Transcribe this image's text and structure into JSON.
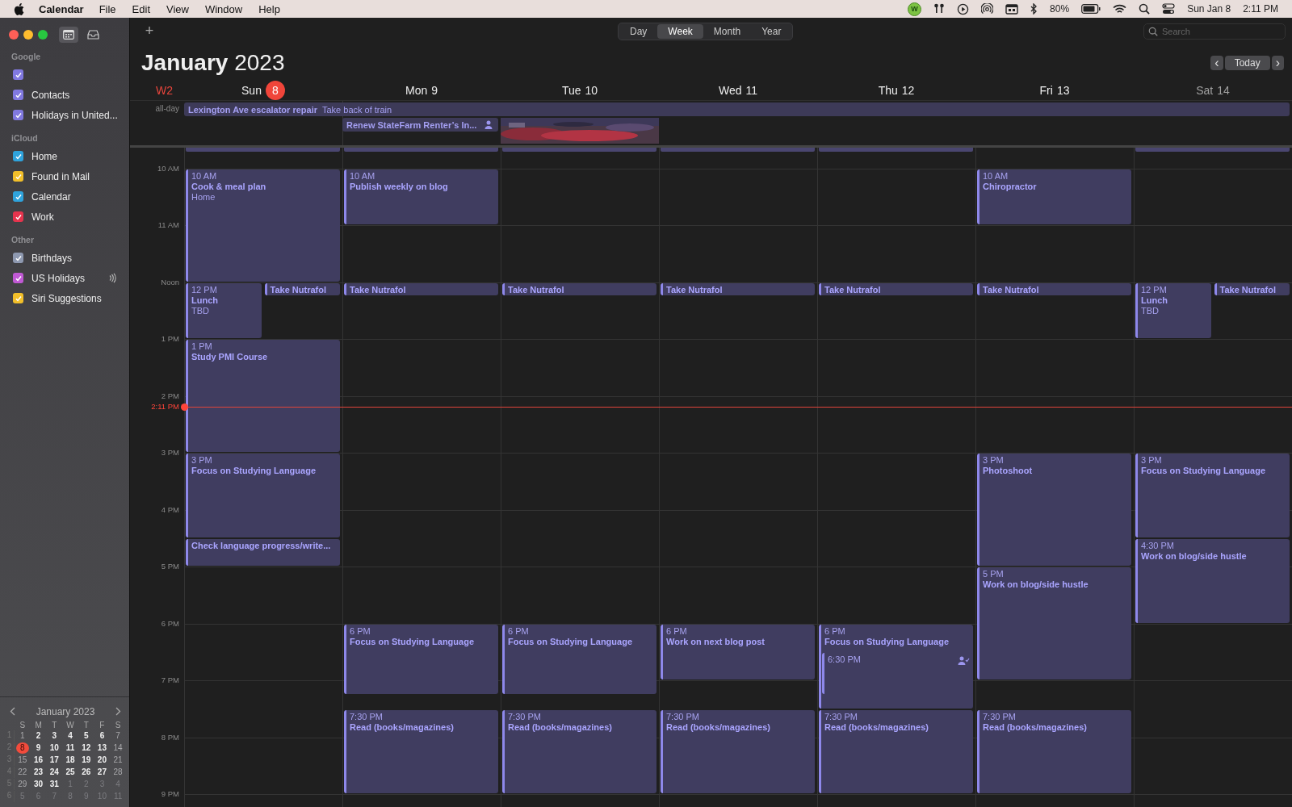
{
  "menu_bar": {
    "app": "Calendar",
    "menus": [
      "File",
      "Edit",
      "View",
      "Window",
      "Help"
    ],
    "status_badge": "W",
    "battery": "80%",
    "date": "Sun Jan 8",
    "time": "2:11 PM"
  },
  "sidebar": {
    "sections": [
      {
        "title": "Google",
        "items": [
          {
            "checked": true,
            "color": "#8179e0"
          },
          {
            "label": "Contacts",
            "checked": true,
            "color": "#8179e0"
          },
          {
            "label": "Holidays in United...",
            "checked": true,
            "color": "#8179e0"
          }
        ]
      },
      {
        "title": "iCloud",
        "items": [
          {
            "label": "Home",
            "checked": true,
            "color": "#2fa3dc"
          },
          {
            "label": "Found in Mail",
            "checked": true,
            "color": "#f2bf2a"
          },
          {
            "label": "Calendar",
            "checked": true,
            "color": "#2fa3dc"
          },
          {
            "label": "Work",
            "checked": true,
            "color": "#e5344d"
          }
        ]
      },
      {
        "title": "Other",
        "items": [
          {
            "label": "Birthdays",
            "checked": true,
            "color": "#8e99b0"
          },
          {
            "label": "US Holidays",
            "checked": true,
            "color": "#c059d4",
            "subscribed": true
          },
          {
            "label": "Siri Suggestions",
            "checked": true,
            "color": "#f2bf2a"
          }
        ]
      }
    ]
  },
  "mini_calendar": {
    "title": "January 2023",
    "weekdays": [
      "S",
      "M",
      "T",
      "W",
      "T",
      "F",
      "S"
    ],
    "weeks": [
      {
        "number": "1",
        "days": [
          {
            "label": "1",
            "muted": false,
            "selected": false
          },
          {
            "label": "2",
            "muted": false,
            "selected": false
          },
          {
            "label": "3",
            "muted": false,
            "selected": false
          },
          {
            "label": "4",
            "muted": false,
            "selected": false
          },
          {
            "label": "5",
            "muted": false,
            "selected": false
          },
          {
            "label": "6",
            "muted": false,
            "selected": false
          },
          {
            "label": "7",
            "muted": false,
            "selected": false
          }
        ]
      },
      {
        "number": "2",
        "days": [
          {
            "label": "8",
            "muted": false,
            "selected": true
          },
          {
            "label": "9",
            "muted": false,
            "selected": false
          },
          {
            "label": "10",
            "muted": false,
            "selected": false
          },
          {
            "label": "11",
            "muted": false,
            "selected": false
          },
          {
            "label": "12",
            "muted": false,
            "selected": false
          },
          {
            "label": "13",
            "muted": false,
            "selected": false
          },
          {
            "label": "14",
            "muted": false,
            "selected": false
          }
        ]
      },
      {
        "number": "3",
        "days": [
          {
            "label": "15",
            "muted": false,
            "selected": false
          },
          {
            "label": "16",
            "muted": false,
            "selected": false
          },
          {
            "label": "17",
            "muted": false,
            "selected": false
          },
          {
            "label": "18",
            "muted": false,
            "selected": false
          },
          {
            "label": "19",
            "muted": false,
            "selected": false
          },
          {
            "label": "20",
            "muted": false,
            "selected": false
          },
          {
            "label": "21",
            "muted": false,
            "selected": false
          }
        ]
      },
      {
        "number": "4",
        "days": [
          {
            "label": "22",
            "muted": false,
            "selected": false
          },
          {
            "label": "23",
            "muted": false,
            "selected": false
          },
          {
            "label": "24",
            "muted": false,
            "selected": false
          },
          {
            "label": "25",
            "muted": false,
            "selected": false
          },
          {
            "label": "26",
            "muted": false,
            "selected": false
          },
          {
            "label": "27",
            "muted": false,
            "selected": false
          },
          {
            "label": "28",
            "muted": false,
            "selected": false
          }
        ]
      },
      {
        "number": "5",
        "days": [
          {
            "label": "29",
            "muted": false,
            "selected": false
          },
          {
            "label": "30",
            "muted": false,
            "selected": false
          },
          {
            "label": "31",
            "muted": false,
            "selected": false
          },
          {
            "label": "1",
            "muted": true,
            "selected": false
          },
          {
            "label": "2",
            "muted": true,
            "selected": false
          },
          {
            "label": "3",
            "muted": true,
            "selected": false
          },
          {
            "label": "4",
            "muted": true,
            "selected": false
          }
        ]
      },
      {
        "number": "6",
        "days": [
          {
            "label": "5",
            "muted": true,
            "selected": false
          },
          {
            "label": "6",
            "muted": true,
            "selected": false
          },
          {
            "label": "7",
            "muted": true,
            "selected": false
          },
          {
            "label": "8",
            "muted": true,
            "selected": false
          },
          {
            "label": "9",
            "muted": true,
            "selected": false
          },
          {
            "label": "10",
            "muted": true,
            "selected": false
          },
          {
            "label": "11",
            "muted": true,
            "selected": false
          }
        ]
      }
    ]
  },
  "toolbar": {
    "add": "+",
    "views": [
      {
        "label": "Day",
        "selected": false
      },
      {
        "label": "Week",
        "selected": true
      },
      {
        "label": "Month",
        "selected": false
      },
      {
        "label": "Year",
        "selected": false
      }
    ],
    "search": {
      "placeholder": "Search"
    },
    "prev": "‹",
    "today": "Today",
    "next": "›"
  },
  "title": {
    "month": "January",
    "year": "2023"
  },
  "week_number": "W2",
  "all_day": {
    "label": "all-day",
    "rows": [
      [
        {
          "kind": "event",
          "wide": true,
          "title": "Lexington Ave escalator repair",
          "note": "Take back of train"
        }
      ],
      [
        {
          "kind": "empty"
        },
        {
          "kind": "event",
          "wide": false,
          "title": "Renew StateFarm Renter’s In...",
          "invitee": true
        },
        {
          "kind": "picture"
        }
      ]
    ]
  },
  "hours": [
    "10 AM",
    "11 AM",
    "Noon",
    "1 PM",
    "2 PM",
    "3 PM",
    "4 PM",
    "5 PM",
    "6 PM",
    "7 PM",
    "8 PM",
    "9 PM"
  ],
  "now": {
    "label": "2:11 PM"
  },
  "days": [
    {
      "name": "Sun",
      "number": "8",
      "today": true,
      "dimmed": false,
      "earlier_event": true,
      "events": [
        {
          "time": "10 AM",
          "title": "Cook & meal plan",
          "location": "Home"
        },
        {
          "time": "12 PM",
          "title": "Lunch",
          "location": "TBD"
        },
        {
          "title": "Take Nutrafol"
        },
        {
          "time": "1 PM",
          "title": "Study PMI Course"
        },
        {
          "time": "3 PM",
          "title": "Focus on Studying Language"
        },
        {
          "title": "Check language progress/write..."
        }
      ]
    },
    {
      "name": "Mon",
      "number": "9",
      "today": false,
      "dimmed": false,
      "earlier_event": true,
      "events": [
        {
          "time": "10 AM",
          "title": "Publish weekly on blog"
        },
        {
          "title": "Take Nutrafol"
        },
        {
          "time": "6 PM",
          "title": "Focus on Studying Language"
        },
        {
          "time": "7:30 PM",
          "title": "Read (books/magazines)"
        }
      ]
    },
    {
      "name": "Tue",
      "number": "10",
      "today": false,
      "dimmed": false,
      "earlier_event": true,
      "events": [
        {
          "title": "Take Nutrafol"
        },
        {
          "time": "6 PM",
          "title": "Focus on Studying Language"
        },
        {
          "time": "7:30 PM",
          "title": "Read (books/magazines)"
        }
      ]
    },
    {
      "name": "Wed",
      "number": "11",
      "today": false,
      "dimmed": false,
      "earlier_event": true,
      "events": [
        {
          "title": "Take Nutrafol"
        },
        {
          "time": "6 PM",
          "title": "Work on next blog post"
        },
        {
          "time": "7:30 PM",
          "title": "Read (books/magazines)"
        }
      ]
    },
    {
      "name": "Thu",
      "number": "12",
      "today": false,
      "dimmed": false,
      "earlier_event": true,
      "events": [
        {
          "title": "Take Nutrafol"
        },
        {
          "time": "6 PM",
          "title": "Focus on Studying Language"
        },
        {
          "time": "6:30 PM",
          "invitee": true
        },
        {
          "time": "7:30 PM",
          "title": "Read (books/magazines)"
        }
      ]
    },
    {
      "name": "Fri",
      "number": "13",
      "today": false,
      "dimmed": false,
      "earlier_event": false,
      "events": [
        {
          "time": "10 AM",
          "title": "Chiropractor"
        },
        {
          "title": "Take Nutrafol"
        },
        {
          "time": "3 PM",
          "title": "Photoshoot"
        },
        {
          "time": "5 PM",
          "title": "Work on blog/side hustle"
        },
        {
          "time": "7:30 PM",
          "title": "Read (books/magazines)"
        }
      ]
    },
    {
      "name": "Sat",
      "number": "14",
      "today": false,
      "dimmed": true,
      "earlier_event": true,
      "events": [
        {
          "time": "12 PM",
          "title": "Lunch",
          "location": "TBD"
        },
        {
          "title": "Take Nutrafol"
        },
        {
          "time": "3 PM",
          "title": "Focus on Studying Language"
        },
        {
          "time": "4:30 PM",
          "title": "Work on blog/side hustle"
        }
      ]
    }
  ]
}
